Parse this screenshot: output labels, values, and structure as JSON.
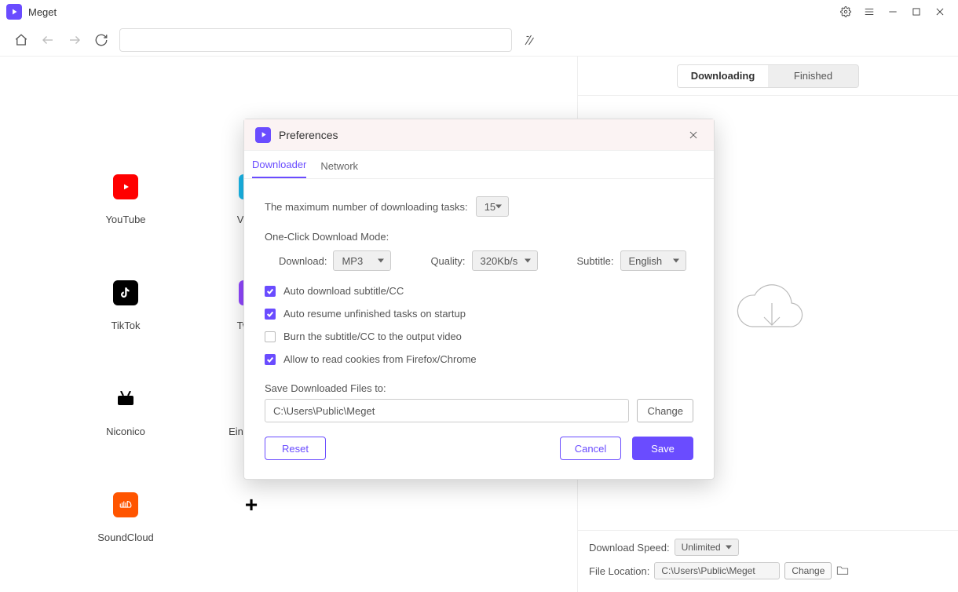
{
  "app": {
    "title": "Meget"
  },
  "nav": {
    "url_placeholder": ""
  },
  "sites": [
    {
      "label": "YouTube"
    },
    {
      "label": "Vimeo"
    },
    {
      "label": "TikTok"
    },
    {
      "label": "Twitch"
    },
    {
      "label": "Niconico"
    },
    {
      "label": "Einthusan"
    },
    {
      "label": "SoundCloud"
    },
    {
      "label": ""
    }
  ],
  "right": {
    "tab_downloading": "Downloading",
    "tab_finished": "Finished",
    "speed_label": "Download Speed:",
    "speed_value": "Unlimited",
    "location_label": "File Location:",
    "location_value": "C:\\Users\\Public\\Meget",
    "change": "Change"
  },
  "modal": {
    "title": "Preferences",
    "tab_downloader": "Downloader",
    "tab_network": "Network",
    "max_tasks_label": "The maximum number of downloading tasks:",
    "max_tasks_value": "15",
    "oneclick_label": "One-Click Download Mode:",
    "download_label": "Download:",
    "download_value": "MP3",
    "quality_label": "Quality:",
    "quality_value": "320Kb/s",
    "subtitle_label": "Subtitle:",
    "subtitle_value": "English",
    "chk_auto_sub": "Auto download subtitle/CC",
    "chk_auto_resume": "Auto resume unfinished tasks on startup",
    "chk_burn": "Burn the subtitle/CC to the output video",
    "chk_cookies": "Allow to read cookies from Firefox/Chrome",
    "save_to_label": "Save Downloaded Files to:",
    "save_to_value": "C:\\Users\\Public\\Meget",
    "change": "Change",
    "reset": "Reset",
    "cancel": "Cancel",
    "save": "Save"
  }
}
